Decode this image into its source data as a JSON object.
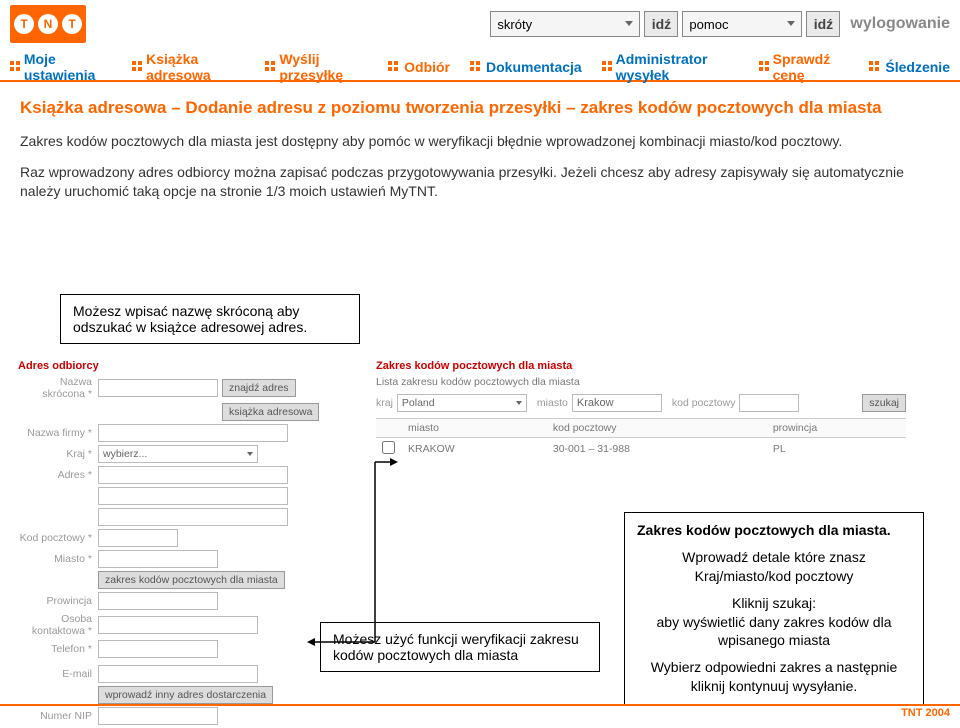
{
  "topbar": {
    "logo_letters": [
      "T",
      "N",
      "T"
    ],
    "shortcuts_label": "skróty",
    "help_label": "pomoc",
    "go_label": "idź",
    "logout_label": "wylogowanie"
  },
  "nav": {
    "items": [
      "Moje ustawienia",
      "Książka adresowa",
      "Wyślij przesyłkę",
      "Odbiór",
      "Dokumentacja",
      "Administrator wysyłek",
      "Sprawdź cenę",
      "Śledzenie"
    ]
  },
  "page": {
    "title": "Książka adresowa – Dodanie adresu z poziomu tworzenia przesyłki – zakres kodów pocztowych dla miasta",
    "para1": "Zakres kodów pocztowych dla miasta jest dostępny aby pomóc w weryfikacji błędnie wprowadzonej kombinacji miasto/kod pocztowy.",
    "para2": "Raz wprowadzony adres odbiorcy można zapisać podczas przygotowywania przesyłki. Jeżeli chcesz aby adresy zapisywały się automatycznie należy uruchomić taką opcje na stronie 1/3 moich ustawień MyTNT."
  },
  "callouts": {
    "c1": "Możesz wpisać nazwę skróconą aby odszukać w książce adresowej adres.",
    "c2": "Możesz użyć funkcji weryfikacji zakresu kodów pocztowych dla miasta",
    "c3_title": "Zakres kodów pocztowych dla miasta.",
    "c3_l1": "Wprowadź detale które znasz Kraj/miasto/kod pocztowy",
    "c3_l2": "Kliknij szukaj:",
    "c3_l3": "aby wyświetlić dany zakres kodów dla wpisanego miasta",
    "c3_l4": "Wybierz odpowiedni zakres a następnie kliknij kontynuuj wysyłanie."
  },
  "form": {
    "section1": "Adres odbiorcy",
    "labels": {
      "short_name": "Nazwa skrócona *",
      "company": "Nazwa firmy *",
      "country": "Kraj *",
      "address": "Adres *",
      "postcode": "Kod pocztowy *",
      "city": "Miasto *",
      "province": "Prowincja",
      "contact": "Osoba kontaktowa *",
      "phone": "Telefon *",
      "email": "E-mail",
      "vat": "Numer NIP"
    },
    "buttons": {
      "find_address": "znajdź adres",
      "address_book": "książka adresowa",
      "postcode_ranges": "zakres kodów pocztowych dla miasta",
      "other_delivery": "wprowadź inny adres dostarczenia",
      "choose": "wybierz...",
      "search": "szukaj"
    },
    "section2_title": "Zakres kodów pocztowych dla miasta",
    "section2_sub": "Lista zakresu kodów pocztowych dla miasta",
    "inline_labels": {
      "country": "kraj",
      "city": "miasto",
      "postcode": "kod pocztowy"
    },
    "values": {
      "country": "Poland",
      "city": "Krakow"
    },
    "chart_data": {
      "type": "table",
      "columns": [
        "miasto",
        "kod pocztowy",
        "prowincja"
      ],
      "rows": [
        [
          "KRAKOW",
          "30-001 – 31-988",
          "PL"
        ]
      ]
    }
  },
  "footer": "TNT 2004"
}
